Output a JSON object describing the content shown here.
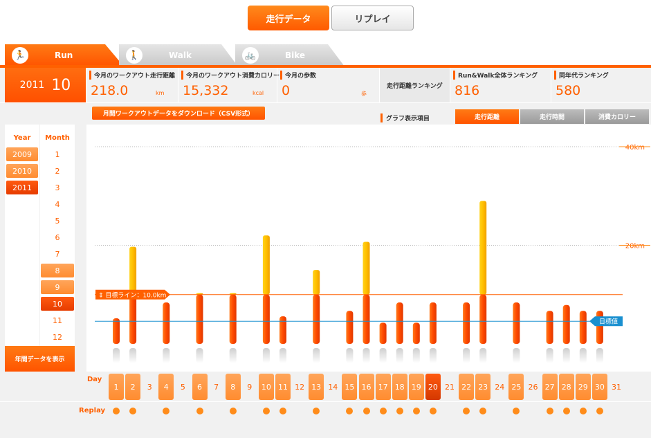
{
  "top_buttons": {
    "running_data": "走行データ",
    "replay": "リプレイ"
  },
  "tabs": {
    "run": "Run",
    "walk": "Walk",
    "bike": "Bike"
  },
  "date": {
    "year": "2011",
    "month": "10"
  },
  "stats": [
    {
      "label": "今月のワークアウト走行距離",
      "value": "218.0",
      "unit": "km"
    },
    {
      "label": "今月のワークアウト消費カロリー",
      "value": "15,332",
      "unit": "kcal"
    },
    {
      "label": "今月の歩数",
      "value": "0",
      "unit": "歩"
    },
    {
      "label": "走行距離ランキング",
      "value": "",
      "unit": ""
    },
    {
      "label": "Run&Walk全体ランキング",
      "value": "816",
      "unit": ""
    },
    {
      "label": "同年代ランキング",
      "value": "580",
      "unit": ""
    }
  ],
  "download_label": "月間ワークアウトデータをダウンロード（CSV形式）",
  "graph_items_label": "グラフ表示項目",
  "graph_buttons": {
    "distance": "走行距離",
    "time": "走行時間",
    "calories": "消費カロリー"
  },
  "year_header": "Year",
  "month_header": "Month",
  "years": [
    "2009",
    "2010",
    "2011"
  ],
  "months": [
    "1",
    "2",
    "3",
    "4",
    "5",
    "6",
    "7",
    "8",
    "9",
    "10",
    "11",
    "12"
  ],
  "yearly_button": "年間データを表示",
  "day_label": "Day",
  "replay_label": "Replay",
  "days": [
    "1",
    "2",
    "3",
    "4",
    "5",
    "6",
    "7",
    "8",
    "9",
    "10",
    "11",
    "12",
    "13",
    "14",
    "15",
    "16",
    "17",
    "18",
    "19",
    "20",
    "21",
    "22",
    "23",
    "24",
    "25",
    "26",
    "27",
    "28",
    "29",
    "30",
    "31"
  ],
  "chart_data": {
    "type": "bar",
    "x": [
      1,
      2,
      4,
      6,
      8,
      10,
      11,
      13,
      15,
      16,
      17,
      18,
      19,
      20,
      22,
      23,
      25,
      27,
      28,
      29,
      30
    ],
    "values": [
      5.2,
      19.7,
      8.4,
      10.3,
      10.3,
      22.0,
      5.6,
      15.0,
      6.7,
      20.7,
      4.3,
      8.4,
      4.3,
      8.4,
      8.4,
      29.0,
      8.4,
      6.7,
      7.9,
      6.7,
      6.7
    ],
    "ylim": [
      0,
      40
    ],
    "ytick_labels": [
      "20km",
      "40km"
    ],
    "goal_line": {
      "label": "目標ライン：10.0km",
      "value": 10.0
    },
    "target_marker": {
      "label": "目標値",
      "value": 4.6
    },
    "colors": {
      "below_goal": "#ff5200",
      "above_goal": "#ffb000"
    }
  }
}
